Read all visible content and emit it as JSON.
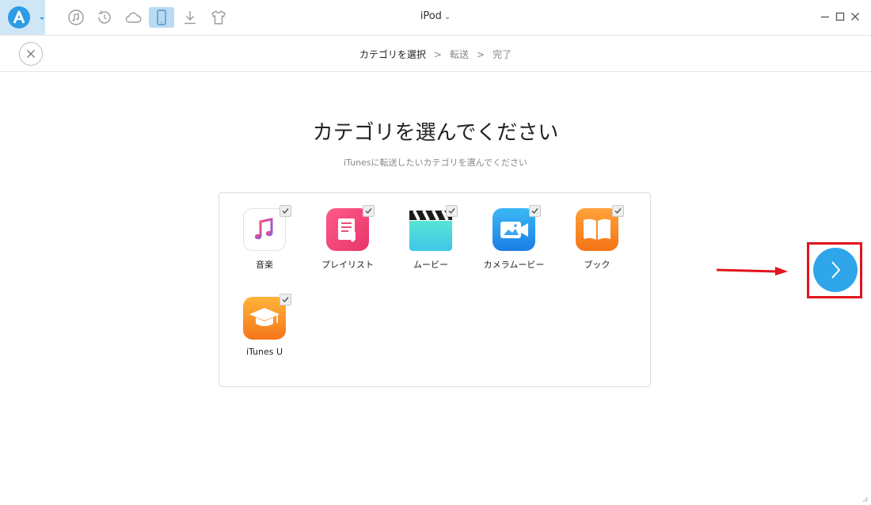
{
  "app": {
    "device_title": "iPod",
    "toolbar_icons": [
      "music-icon",
      "backup-restore-icon",
      "cloud-icon",
      "device-icon",
      "download-icon",
      "tshirt-icon"
    ],
    "active_tool": "device-icon"
  },
  "steps": {
    "items": [
      "カテゴリを選択",
      "転送",
      "完了"
    ],
    "separator": ">",
    "current_index": 0
  },
  "main": {
    "heading": "カテゴリを選んでください",
    "subheading": "iTunesに転送したいカテゴリを選んでください"
  },
  "categories": [
    {
      "label": "音楽",
      "checked": true
    },
    {
      "label": "プレイリスト",
      "checked": true
    },
    {
      "label": "ムービー",
      "checked": true
    },
    {
      "label": "カメラムービー",
      "checked": true
    },
    {
      "label": "ブック",
      "checked": true
    },
    {
      "label": "iTunes U",
      "checked": true
    }
  ],
  "colors": {
    "accent": "#2fa6ea",
    "highlight_frame": "#e0141c",
    "annotation_arrow": "#e0141c"
  }
}
